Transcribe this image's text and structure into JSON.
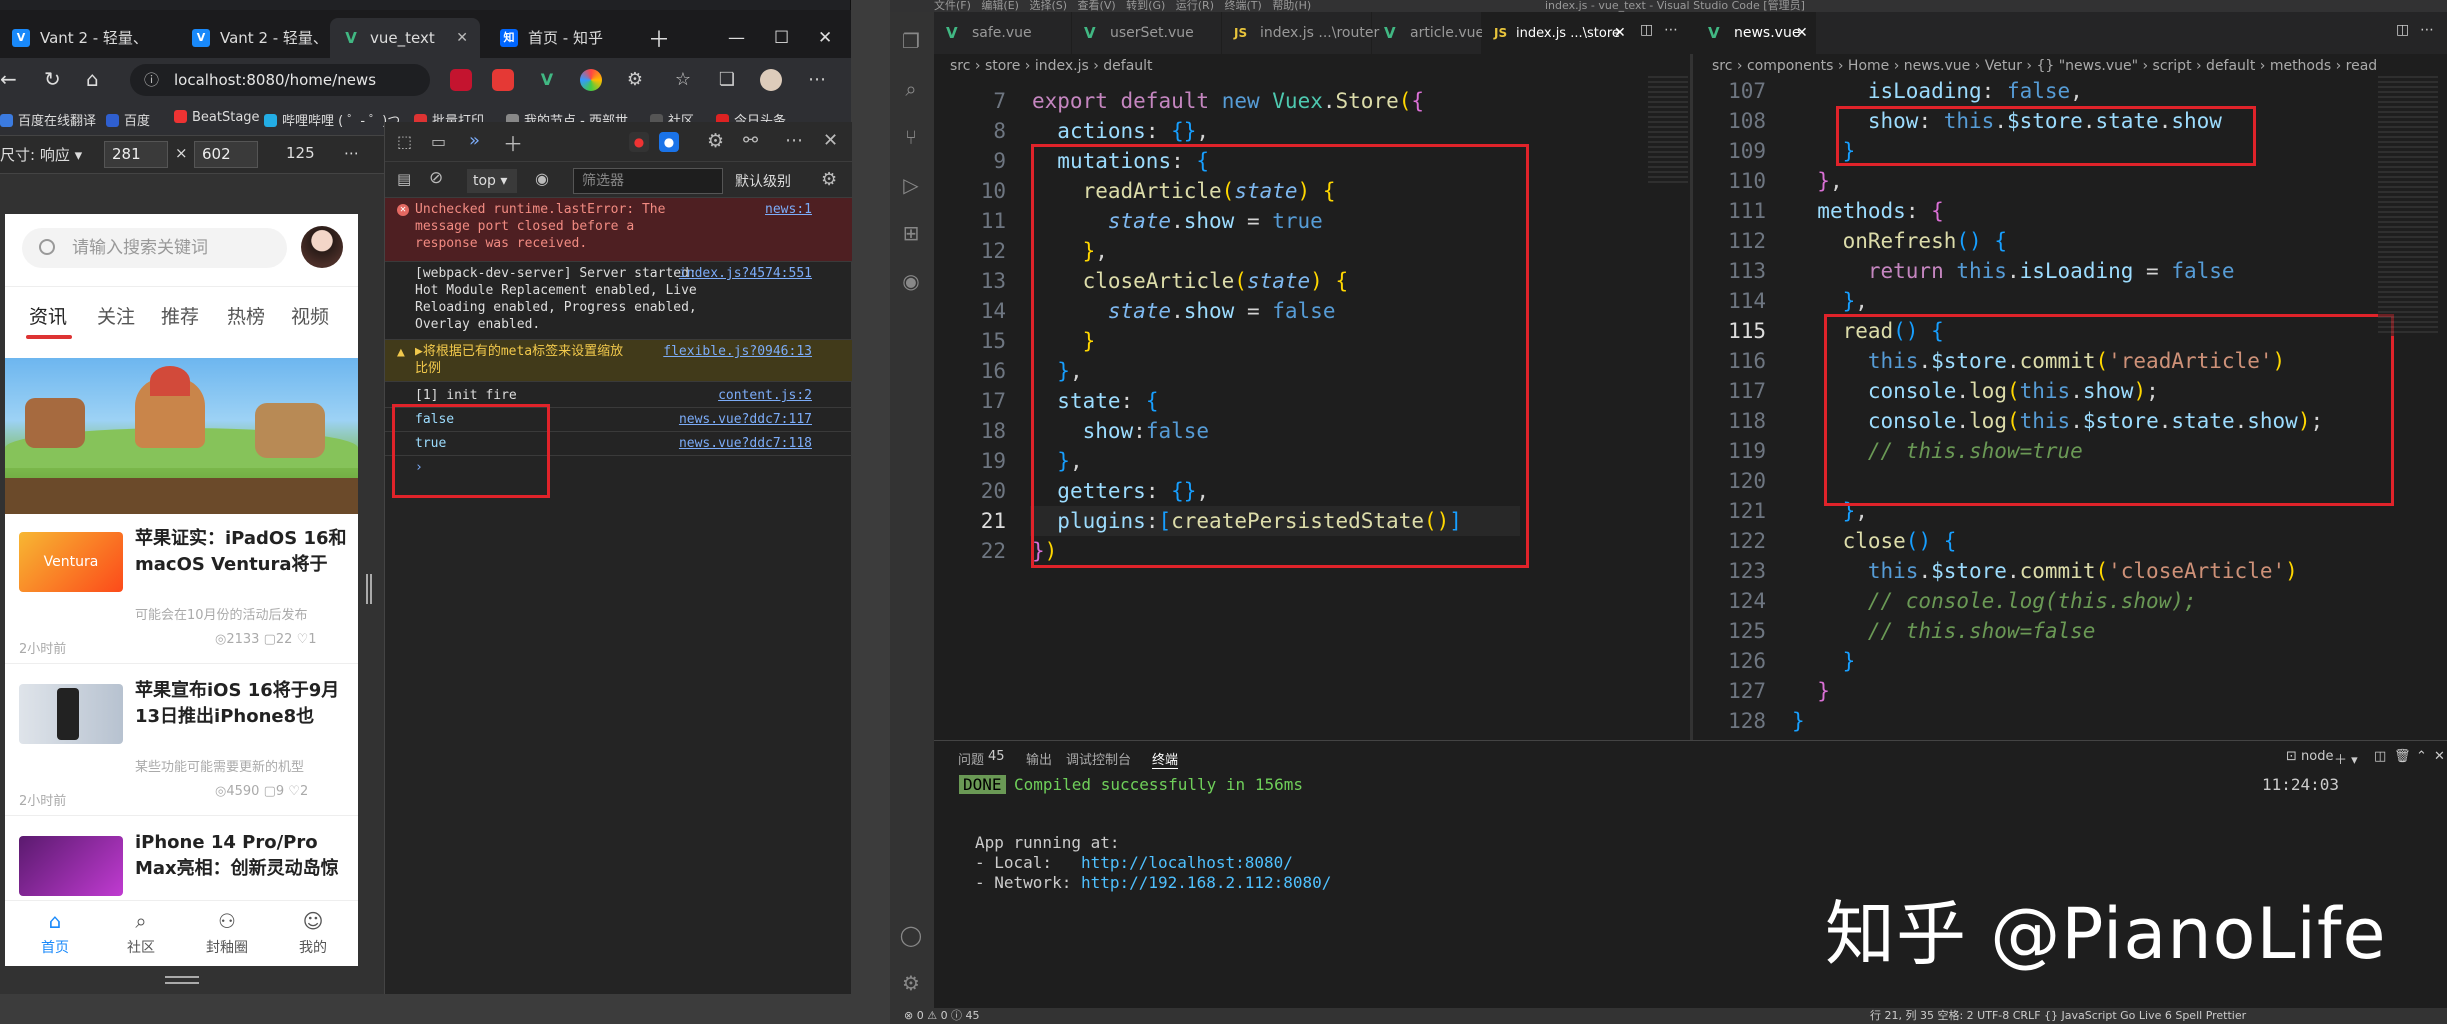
{
  "browser": {
    "tabs": [
      "Vant 2 - 轻量、",
      "Vant 2 - 轻量、",
      "vue_text",
      "首页 - 知乎"
    ],
    "url": "localhost:8080/home/news",
    "bookmarks": [
      "百度在线翻译",
      "百度",
      "BeatStage",
      "哔哩哔哩 ( ゜- ゜)つ...",
      "批量打印",
      "我的节点 - 西部世...",
      "社区_",
      "今日头条"
    ],
    "device": {
      "label": "尺寸: 响应",
      "width": "281",
      "times": "×",
      "height": "602",
      "zoom": "125"
    }
  },
  "phone": {
    "search_placeholder": "请输入搜索关键词",
    "tabs": [
      "资讯",
      "关注",
      "推荐",
      "热榜",
      "视频"
    ],
    "news": [
      {
        "title": "苹果证实：iPadOS 16和macOS Ventura将于1...",
        "sub": "可能会在10月份的活动后发布",
        "time": "2小时前",
        "views": "2133",
        "comments": "22",
        "likes": "1",
        "thumb_text": "Ventura"
      },
      {
        "title": "苹果宣布iOS 16将于9月13日推出iPhone8也能...",
        "sub": "某些功能可能需要更新的机型",
        "time": "2小时前",
        "views": "4590",
        "comments": "9",
        "likes": "2",
        "thumb_text": ""
      },
      {
        "title": "iPhone 14 Pro/Pro Max亮相：创新灵动岛惊艳...",
        "sub": "",
        "time": "",
        "views": "",
        "comments": "",
        "likes": "",
        "thumb_text": ""
      }
    ],
    "bottom_nav": [
      "首页",
      "社区",
      "封釉圈",
      "我的"
    ]
  },
  "devtools": {
    "context": "top",
    "filter_placeholder": "筛选器",
    "level": "默认级别",
    "console": [
      {
        "text": "Unchecked runtime.lastError: The message port closed before a response was received.",
        "src": "news:1",
        "kind": "err"
      },
      {
        "text": "[webpack-dev-server] Server started: Hot Module Replacement enabled, Live Reloading enabled, Progress enabled, Overlay enabled.",
        "src": "index.js?4574:551",
        "kind": "log"
      },
      {
        "text": "▶将根据已有的meta标签来设置缩放比例",
        "src": "flexible.js?0946:13",
        "kind": "warn"
      },
      {
        "text": "[1] init fire",
        "src": "content.js:2",
        "kind": "log"
      },
      {
        "text": "false",
        "src": "news.vue?ddc7:117",
        "kind": "log"
      },
      {
        "text": "true",
        "src": "news.vue?ddc7:118",
        "kind": "log"
      }
    ]
  },
  "vscode": {
    "title": "index.js - vue_text - Visual Studio Code [管理员]",
    "menu": [
      "文件(F)",
      "编辑(E)",
      "选择(S)",
      "查看(V)",
      "转到(G)",
      "运行(R)",
      "终端(T)",
      "帮助(H)"
    ],
    "tabs_left": [
      "safe.vue",
      "userSet.vue",
      "index.js ...\\router",
      "article.vue",
      "index.js ...\\store"
    ],
    "tabs_right": [
      "news.vue"
    ],
    "crumb_left": "src › store › index.js › default",
    "crumb_right": "src › components › Home › news.vue › Vetur › {} \"news.vue\" › script › default › methods › read",
    "left_code_lines": [
      "7",
      "8",
      "9",
      "10",
      "11",
      "12",
      "13",
      "14",
      "15",
      "16",
      "17",
      "18",
      "19",
      "20",
      "21",
      "22"
    ],
    "right_code_lines": [
      "107",
      "108",
      "109",
      "110",
      "111",
      "112",
      "113",
      "114",
      "115",
      "116",
      "117",
      "118",
      "119",
      "120",
      "121",
      "122",
      "123",
      "124",
      "125",
      "126",
      "127",
      "128"
    ],
    "panel_tabs": [
      "问题",
      "45",
      "输出",
      "调试控制台",
      "终端"
    ],
    "terminal": {
      "done": "DONE",
      "compiled": "Compiled successfully in 156ms",
      "time": "11:24:03",
      "running": "App running at:",
      "local_label": "- Local:   ",
      "local_url": "http://localhost:8080/",
      "network_label": "- Network: ",
      "network_url": "http://192.168.2.112:8080/",
      "shell": "node"
    },
    "status_left": "⊗ 0 ⚠ 0 ⓘ 45",
    "status_right": "行 21, 列 35   空格: 2   UTF-8   CRLF   {} JavaScript   Go Live   6 Spell   Prettier"
  },
  "watermark": "知乎 @PianoLife"
}
